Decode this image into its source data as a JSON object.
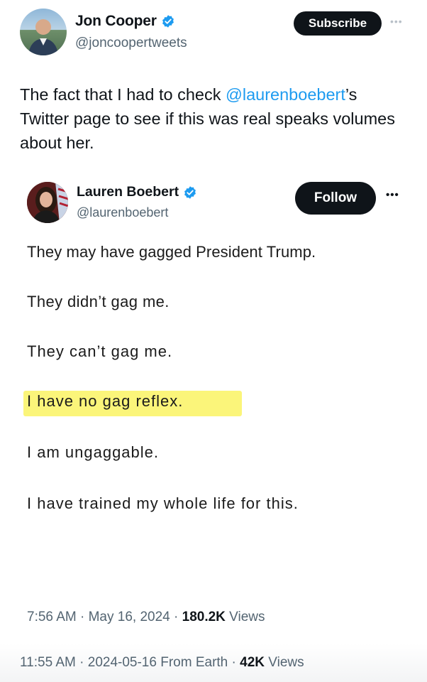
{
  "quote_tweet": {
    "author_name": "Jon Cooper",
    "author_handle": "@joncoopertweets",
    "subscribe_label": "Subscribe",
    "more_icon": "more-dots-icon",
    "text_before_mention": "The fact that I had to check ",
    "mention": "@laurenboebert",
    "text_after_mention": "’s Twitter page to see if this was real speaks volumes about her.",
    "timestamp": "11:55 AM · 2024-05-16 From Earth · ",
    "views_count": "42K",
    "views_label": " Views"
  },
  "embedded_tweet": {
    "author_name": "Lauren Boebert",
    "author_handle": "@laurenboebert",
    "follow_label": "Follow",
    "more_icon": "more-dots-icon",
    "lines": [
      "They may have gagged President Trump.",
      "They didn’t gag me.",
      "They can’t gag me.",
      "I have no gag reflex.",
      "I am ungaggable.",
      "I have trained my whole life for this."
    ],
    "highlight_color": "#fbf57a",
    "timestamp": "7:56 AM · May 16, 2024 · ",
    "views_count": "180.2K",
    "views_label": " Views"
  },
  "colors": {
    "verified_badge": "#1d9bf0",
    "mention": "#1d9bf0",
    "button_bg": "#0f1419"
  }
}
